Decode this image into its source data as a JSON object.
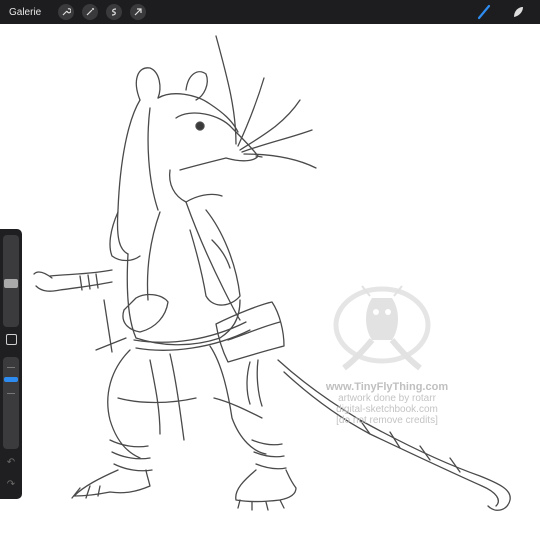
{
  "topbar": {
    "gallery_label": "Galerie",
    "tools": [
      "wrench-icon",
      "magic-wand-icon",
      "selection-icon",
      "transform-arrow-icon"
    ],
    "right_tools": [
      "brush-icon",
      "smudge-icon"
    ],
    "accent_color": "#2e8cf0"
  },
  "watermark": {
    "site": "www.TinyFlyThing.com",
    "line2": "artwork done by rotarr",
    "line3": "digital-sketchbook.com",
    "line4": "[do not remove credits]"
  },
  "sidebar": {
    "brush_size_level": 0.5,
    "opacity_level": 0.2
  }
}
